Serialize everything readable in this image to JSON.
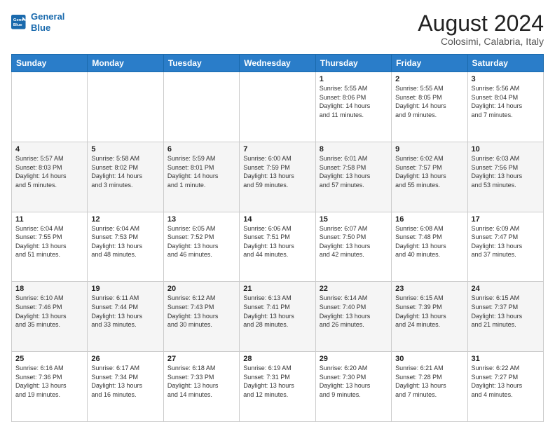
{
  "logo": {
    "line1": "General",
    "line2": "Blue"
  },
  "title": "August 2024",
  "subtitle": "Colosimi, Calabria, Italy",
  "days": [
    "Sunday",
    "Monday",
    "Tuesday",
    "Wednesday",
    "Thursday",
    "Friday",
    "Saturday"
  ],
  "weeks": [
    [
      {
        "day": "",
        "info": ""
      },
      {
        "day": "",
        "info": ""
      },
      {
        "day": "",
        "info": ""
      },
      {
        "day": "",
        "info": ""
      },
      {
        "day": "1",
        "info": "Sunrise: 5:55 AM\nSunset: 8:06 PM\nDaylight: 14 hours\nand 11 minutes."
      },
      {
        "day": "2",
        "info": "Sunrise: 5:55 AM\nSunset: 8:05 PM\nDaylight: 14 hours\nand 9 minutes."
      },
      {
        "day": "3",
        "info": "Sunrise: 5:56 AM\nSunset: 8:04 PM\nDaylight: 14 hours\nand 7 minutes."
      }
    ],
    [
      {
        "day": "4",
        "info": "Sunrise: 5:57 AM\nSunset: 8:03 PM\nDaylight: 14 hours\nand 5 minutes."
      },
      {
        "day": "5",
        "info": "Sunrise: 5:58 AM\nSunset: 8:02 PM\nDaylight: 14 hours\nand 3 minutes."
      },
      {
        "day": "6",
        "info": "Sunrise: 5:59 AM\nSunset: 8:01 PM\nDaylight: 14 hours\nand 1 minute."
      },
      {
        "day": "7",
        "info": "Sunrise: 6:00 AM\nSunset: 7:59 PM\nDaylight: 13 hours\nand 59 minutes."
      },
      {
        "day": "8",
        "info": "Sunrise: 6:01 AM\nSunset: 7:58 PM\nDaylight: 13 hours\nand 57 minutes."
      },
      {
        "day": "9",
        "info": "Sunrise: 6:02 AM\nSunset: 7:57 PM\nDaylight: 13 hours\nand 55 minutes."
      },
      {
        "day": "10",
        "info": "Sunrise: 6:03 AM\nSunset: 7:56 PM\nDaylight: 13 hours\nand 53 minutes."
      }
    ],
    [
      {
        "day": "11",
        "info": "Sunrise: 6:04 AM\nSunset: 7:55 PM\nDaylight: 13 hours\nand 51 minutes."
      },
      {
        "day": "12",
        "info": "Sunrise: 6:04 AM\nSunset: 7:53 PM\nDaylight: 13 hours\nand 48 minutes."
      },
      {
        "day": "13",
        "info": "Sunrise: 6:05 AM\nSunset: 7:52 PM\nDaylight: 13 hours\nand 46 minutes."
      },
      {
        "day": "14",
        "info": "Sunrise: 6:06 AM\nSunset: 7:51 PM\nDaylight: 13 hours\nand 44 minutes."
      },
      {
        "day": "15",
        "info": "Sunrise: 6:07 AM\nSunset: 7:50 PM\nDaylight: 13 hours\nand 42 minutes."
      },
      {
        "day": "16",
        "info": "Sunrise: 6:08 AM\nSunset: 7:48 PM\nDaylight: 13 hours\nand 40 minutes."
      },
      {
        "day": "17",
        "info": "Sunrise: 6:09 AM\nSunset: 7:47 PM\nDaylight: 13 hours\nand 37 minutes."
      }
    ],
    [
      {
        "day": "18",
        "info": "Sunrise: 6:10 AM\nSunset: 7:46 PM\nDaylight: 13 hours\nand 35 minutes."
      },
      {
        "day": "19",
        "info": "Sunrise: 6:11 AM\nSunset: 7:44 PM\nDaylight: 13 hours\nand 33 minutes."
      },
      {
        "day": "20",
        "info": "Sunrise: 6:12 AM\nSunset: 7:43 PM\nDaylight: 13 hours\nand 30 minutes."
      },
      {
        "day": "21",
        "info": "Sunrise: 6:13 AM\nSunset: 7:41 PM\nDaylight: 13 hours\nand 28 minutes."
      },
      {
        "day": "22",
        "info": "Sunrise: 6:14 AM\nSunset: 7:40 PM\nDaylight: 13 hours\nand 26 minutes."
      },
      {
        "day": "23",
        "info": "Sunrise: 6:15 AM\nSunset: 7:39 PM\nDaylight: 13 hours\nand 24 minutes."
      },
      {
        "day": "24",
        "info": "Sunrise: 6:15 AM\nSunset: 7:37 PM\nDaylight: 13 hours\nand 21 minutes."
      }
    ],
    [
      {
        "day": "25",
        "info": "Sunrise: 6:16 AM\nSunset: 7:36 PM\nDaylight: 13 hours\nand 19 minutes."
      },
      {
        "day": "26",
        "info": "Sunrise: 6:17 AM\nSunset: 7:34 PM\nDaylight: 13 hours\nand 16 minutes."
      },
      {
        "day": "27",
        "info": "Sunrise: 6:18 AM\nSunset: 7:33 PM\nDaylight: 13 hours\nand 14 minutes."
      },
      {
        "day": "28",
        "info": "Sunrise: 6:19 AM\nSunset: 7:31 PM\nDaylight: 13 hours\nand 12 minutes."
      },
      {
        "day": "29",
        "info": "Sunrise: 6:20 AM\nSunset: 7:30 PM\nDaylight: 13 hours\nand 9 minutes."
      },
      {
        "day": "30",
        "info": "Sunrise: 6:21 AM\nSunset: 7:28 PM\nDaylight: 13 hours\nand 7 minutes."
      },
      {
        "day": "31",
        "info": "Sunrise: 6:22 AM\nSunset: 7:27 PM\nDaylight: 13 hours\nand 4 minutes."
      }
    ]
  ]
}
